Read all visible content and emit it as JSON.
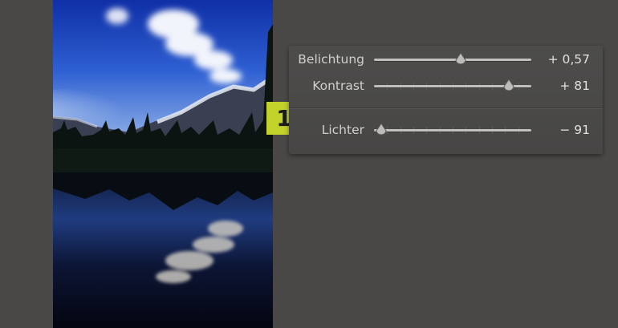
{
  "photo": {
    "icon": "mountain-lake-reflection-photo"
  },
  "adjustments": [
    {
      "label": "Belichtung",
      "value": "+ 0,57",
      "level": 0.55,
      "ticked": false
    },
    {
      "label": "Kontrast",
      "value": "+ 81",
      "level": 0.855,
      "ticked": true
    },
    {
      "label": "Lichter",
      "value": "− 91",
      "level": 0.045,
      "ticked": true
    }
  ],
  "badge": {
    "text": "1",
    "color": "#c3d22a"
  }
}
